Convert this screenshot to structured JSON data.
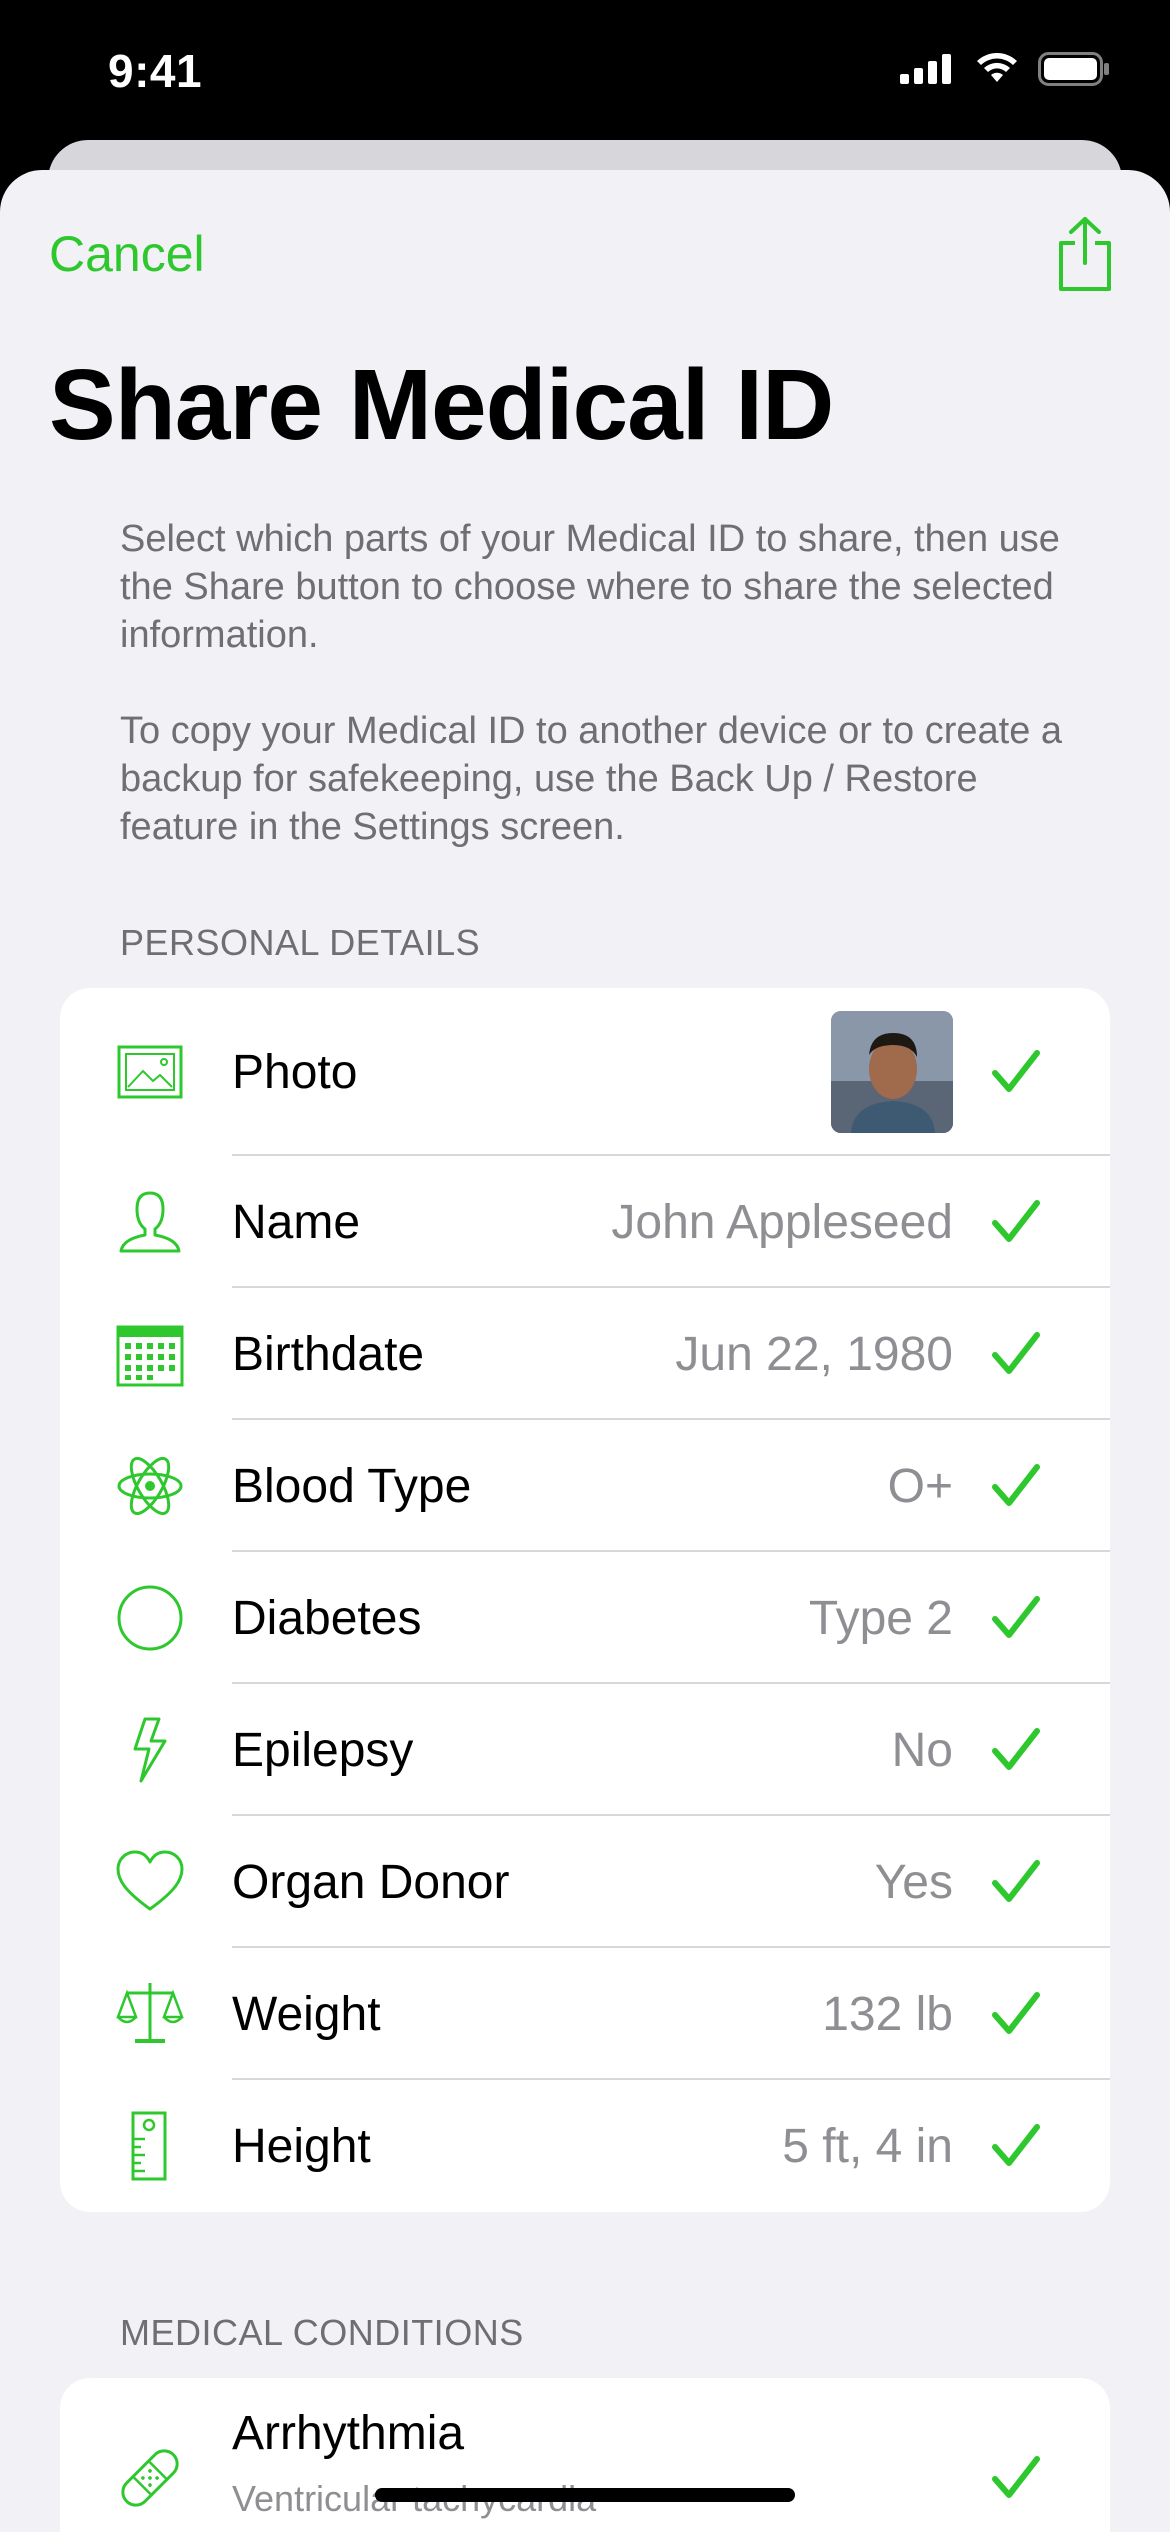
{
  "status": {
    "time": "9:41"
  },
  "toolbar": {
    "cancel_label": "Cancel"
  },
  "page": {
    "title": "Share Medical ID"
  },
  "description": {
    "para1": "Select which parts of your Medical ID to share, then use the Share button to choose where to share the selected information.",
    "para2": "To copy your Medical ID to another device or to create a backup for safekeeping, use the Back Up / Restore feature in the Settings screen."
  },
  "personal": {
    "header": "PERSONAL DETAILS",
    "rows": [
      {
        "label": "Photo",
        "value": "",
        "icon": "photo-icon"
      },
      {
        "label": "Name",
        "value": "John Appleseed",
        "icon": "person-icon"
      },
      {
        "label": "Birthdate",
        "value": "Jun 22, 1980",
        "icon": "calendar-icon"
      },
      {
        "label": "Blood Type",
        "value": "O+",
        "icon": "atom-icon"
      },
      {
        "label": "Diabetes",
        "value": "Type 2",
        "icon": "circle-icon"
      },
      {
        "label": "Epilepsy",
        "value": "No",
        "icon": "bolt-icon"
      },
      {
        "label": "Organ Donor",
        "value": "Yes",
        "icon": "heart-icon"
      },
      {
        "label": "Weight",
        "value": "132 lb",
        "icon": "scale-icon"
      },
      {
        "label": "Height",
        "value": "5 ft, 4 in",
        "icon": "ruler-icon"
      }
    ]
  },
  "conditions": {
    "header": "MEDICAL CONDITIONS",
    "rows": [
      {
        "label": "Arrhythmia",
        "sub": "Ventricular tachycardia",
        "icon": "bandage-icon"
      }
    ]
  },
  "colors": {
    "accent": "#2ec82e",
    "background": "#f1f1f6"
  }
}
